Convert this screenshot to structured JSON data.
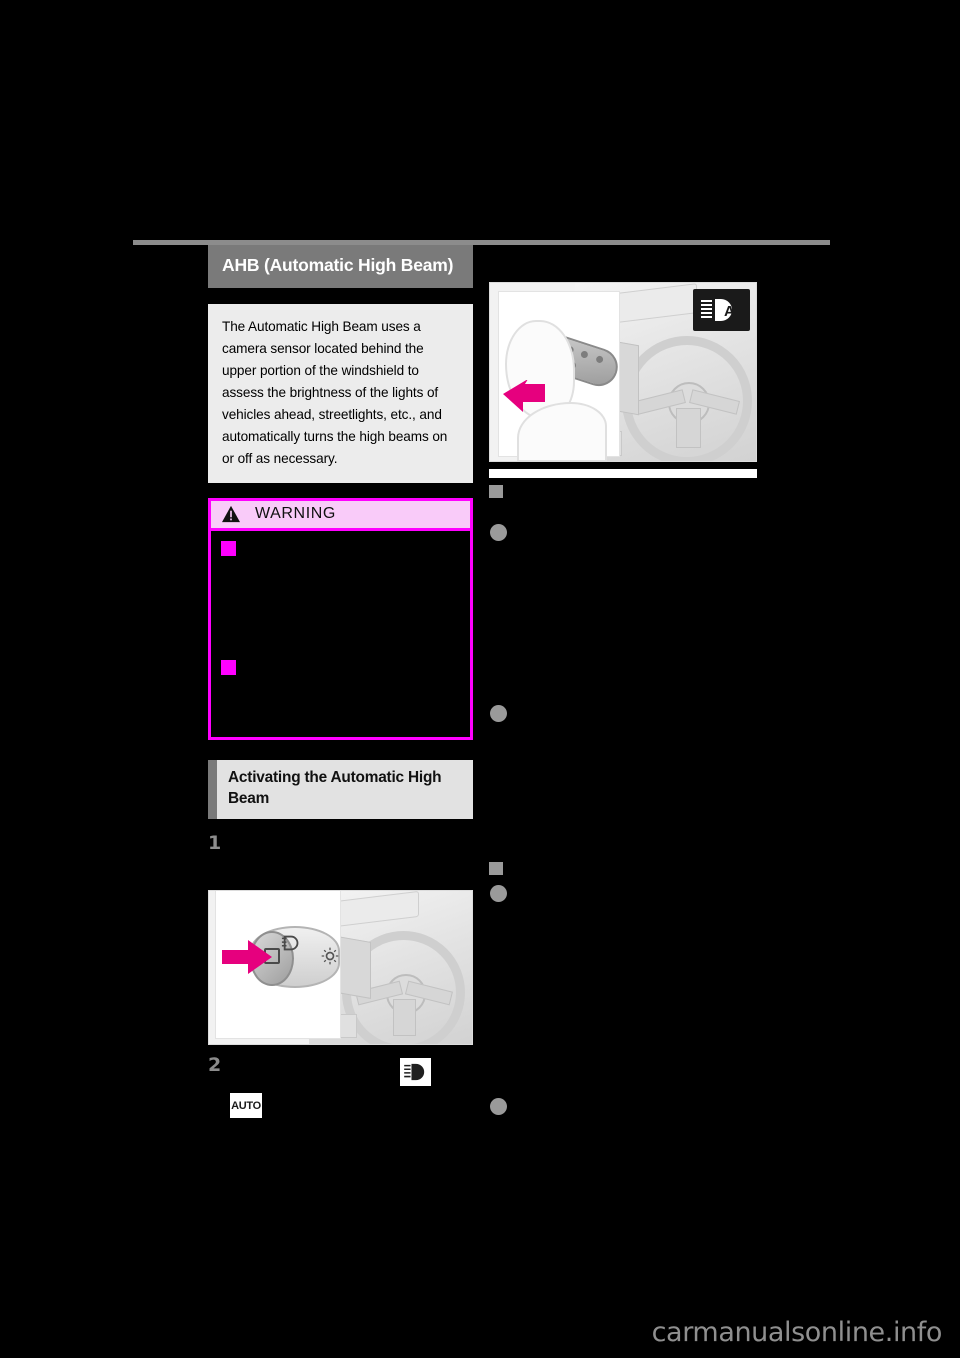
{
  "page": {
    "background_color": "#000000",
    "watermark": "carmanualsonline.info"
  },
  "left_column": {
    "section_title": "AHB (Automatic High Beam)",
    "intro_paragraph": "The Automatic High Beam uses a camera sensor located behind the upper portion of the windshield to assess the brightness of the lights of vehicles ahead, streetlights, etc., and automatically turns the high beams on or off as necessary.",
    "warning": {
      "label": "WARNING",
      "icon": "warning-triangle-icon",
      "border_color": "#ff00ff",
      "header_background": "#f9cbf9",
      "bullets": [
        "",
        ""
      ]
    },
    "subsection_title": "Activating the Automatic High Beam",
    "steps": [
      {
        "number": "1",
        "text": ""
      },
      {
        "number": "2",
        "text": ""
      }
    ],
    "illustration": {
      "name": "headlight-switch-dial-illustration",
      "arrow_color": "#e6007e",
      "parts": [
        "headlight-switch-dial",
        "steering-wheel",
        "dashboard"
      ]
    },
    "inline_pictograms": [
      {
        "name": "high-beam-headlight-icon",
        "label": ""
      },
      {
        "name": "auto-headlight-icon",
        "label": "AUTO"
      }
    ]
  },
  "right_column": {
    "illustration": {
      "name": "headlight-lever-illustration",
      "arrow_color": "#e6007e",
      "parts": [
        "turn-signal-lever",
        "hand",
        "steering-wheel",
        "dashboard"
      ],
      "indicator_badge": {
        "name": "ahb-indicator-icon",
        "letter": "A",
        "background": "#1a1a1a"
      }
    },
    "sections": [
      {
        "heading": "",
        "bullets": [
          "",
          ""
        ]
      },
      {
        "heading": "",
        "bullets": [
          "",
          ""
        ]
      }
    ]
  },
  "colors": {
    "accent_magenta": "#ff00ff",
    "arrow_pink": "#e6007e",
    "title_bar_gray": "#7a7a7a",
    "intro_bg": "#ececec",
    "subhead_bg": "#e2e2e2",
    "bullet_gray": "#9a9a9a",
    "rule_gray": "#8c8c8c"
  }
}
